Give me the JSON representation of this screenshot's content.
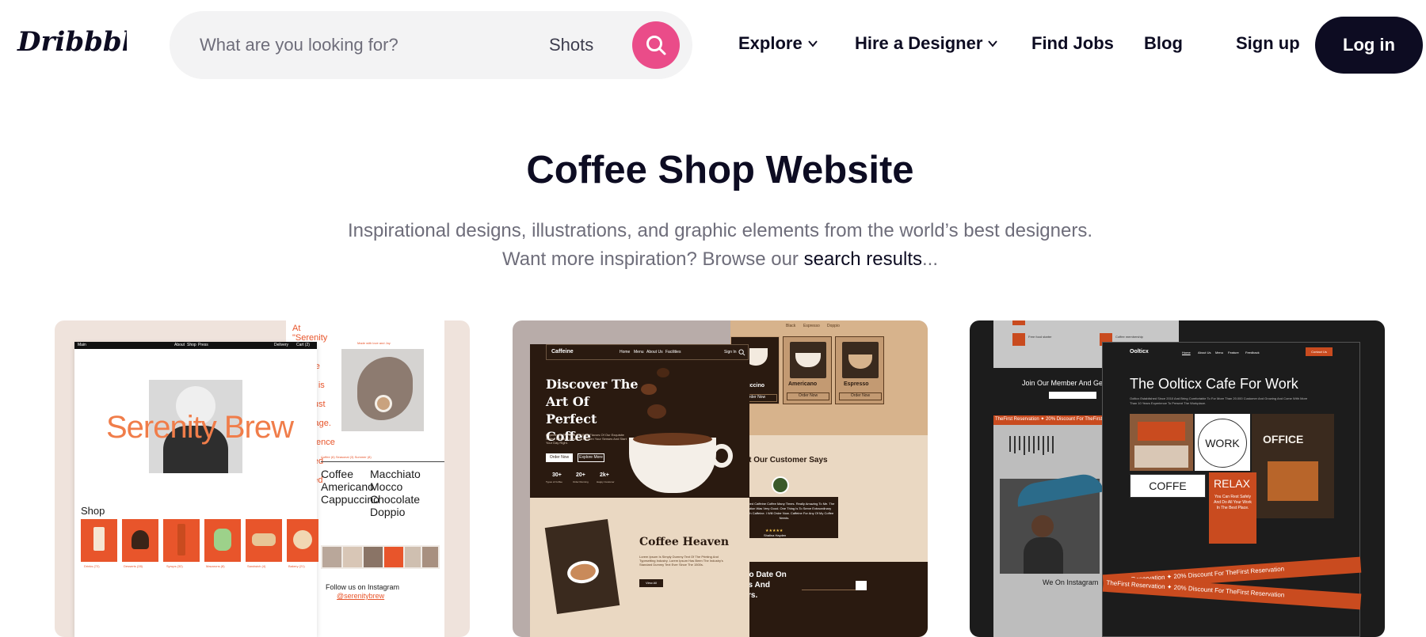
{
  "header": {
    "logo_text": "Dribbble",
    "search": {
      "placeholder": "What are you looking for?",
      "type_label": "Shots"
    },
    "nav": {
      "explore": "Explore",
      "hire": "Hire a Designer",
      "jobs": "Find Jobs",
      "blog": "Blog"
    },
    "signup": "Sign up",
    "login": "Log in"
  },
  "hero": {
    "title": "Coffee Shop Website",
    "subtitle_line1": "Inspirational designs, illustrations, and graphic elements from the world’s best designers.",
    "subtitle_line2_prefix": "Want more inspiration? Browse our ",
    "subtitle_link": "search results",
    "subtitle_suffix": "..."
  },
  "cards": [
    {
      "brand": "Serenity Brew",
      "nav_left": "Main",
      "nav_items": [
        "About",
        "Shop",
        "Press"
      ],
      "nav_right": [
        "Delivery",
        "Cart (2)"
      ],
      "quote": "At \"Serenity Brew\" we believe that coffee is more than just a beverage. It's an experience to be savored and enjoyed",
      "shop_label": "Shop",
      "shop_items": [
        "Drinks (72)",
        "Desserts (28)",
        "Syrups (32)",
        "Macarons (8)",
        "Sandwich (4)",
        "Bakery (21)"
      ],
      "menu_col1": [
        "Coffee",
        "Americano",
        "Cappuccino"
      ],
      "menu_col2": [
        "Macchiato",
        "Mocco",
        "Chocolate",
        "Doppio"
      ],
      "instagram_label": "Follow us on Instagram",
      "instagram_handle": "@serenitybrew"
    },
    {
      "brand": "Caffeine",
      "nav_items": [
        "Home",
        "Menu",
        "About Us",
        "Facilities"
      ],
      "signin": "Sign In",
      "headline": "Discover The Art Of Perfect Coffee",
      "body": "Experience The Rich And Bold Flavors Of Our Exquisite Coffee Blends, Crafted To Awaken Your Senses And Start Your Day Right.",
      "btn_order": "Order Now",
      "btn_explore": "Explore More",
      "stats": [
        {
          "value": "30+",
          "label": "Types of Coffee"
        },
        {
          "value": "20+",
          "label": "Order Running"
        },
        {
          "value": "2k+",
          "label": "Happy Customer"
        }
      ],
      "menu_tabs": [
        "Black",
        "Espresso",
        "Doppio"
      ],
      "products": [
        "Cappuccino",
        "Americano",
        "Espresso"
      ],
      "product_btn": "Order Now",
      "testimonial_title": "What Our Customer Says",
      "testimonial_text": "I Have Tested Caffeine Coffee Many Times. Really Amazing To Me. The Combination Was Very Good. One Thing Is To Serve Extraordinary Coffee With Caffeine. I Will Order Now. Caffeine For Any Of My Coffee Needs.",
      "testimonial_name": "Shalina Hayden",
      "section_title": "Coffee Heaven",
      "section_body": "Lorem Ipsum Is Simply Dummy Text Of The Printing And Typesetting Industry. Lorem Ipsum Has Been The Industry's Standard Dummy Text Ever Since The 1500s.",
      "view_all": "View All",
      "newsletter_title": "Up To Date On News And Offers."
    },
    {
      "brand": "Oolticx",
      "nav_items": [
        "Home",
        "About Us",
        "Menu",
        "Feature",
        "Feedback"
      ],
      "contact_btn": "Contact Us",
      "headline": "The Oolticx Cafe For Work",
      "body": "Oolticx Established Since 2010 And Bring Comfortable To For More Than 20.000 Customer And Growing And Come With More Than 10 Years Experience To Present The Workplace.",
      "tiles": [
        "WORK",
        "OFFICE",
        "COFFE",
        "RELAX"
      ],
      "relax_body": "You Can Rest Safely And Do All Your Work In The Best Place.",
      "member_label": "Join Our Member And Get Discount",
      "promo": "TheFirst Reservation  ✦  20% Discount For TheFirst Reservation",
      "instagram_label": "We On Instagram",
      "side_items": [
        "Free food starter",
        "Coffee membership"
      ]
    }
  ]
}
